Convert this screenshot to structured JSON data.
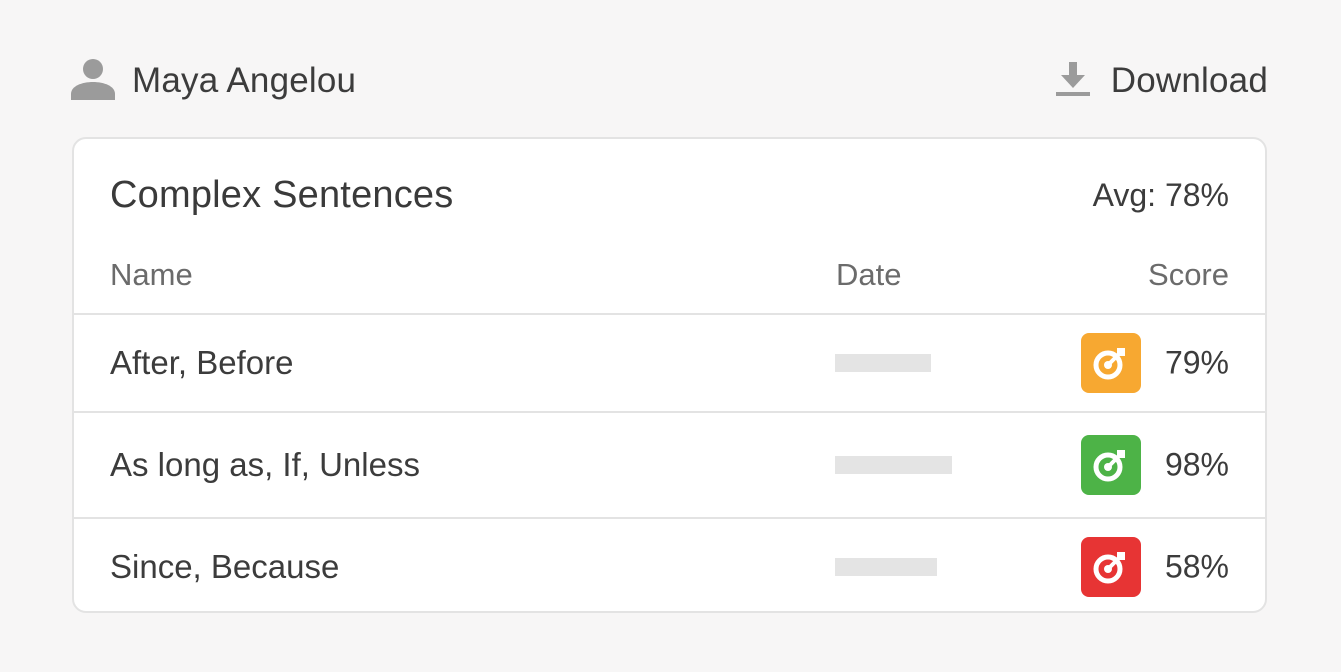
{
  "user": {
    "name": "Maya Angelou",
    "icon": "person-icon"
  },
  "download": {
    "label": "Download",
    "icon": "download-icon"
  },
  "card": {
    "title": "Complex Sentences",
    "avg": "Avg: 78%",
    "columns": {
      "name": "Name",
      "date": "Date",
      "score": "Score"
    },
    "rows": [
      {
        "name": "After, Before",
        "score": "79%",
        "score_fraction": 0.79,
        "badge_color": "#f7a831",
        "icon": "target-icon"
      },
      {
        "name": "As long as, If, Unless",
        "score": "98%",
        "score_fraction": 0.98,
        "badge_color": "#4db347",
        "icon": "target-icon"
      },
      {
        "name": "Since, Because",
        "score": "58%",
        "score_fraction": 0.58,
        "badge_color": "#e73434",
        "icon": "target-icon"
      }
    ]
  },
  "colors": {
    "background": "#f7f6f6",
    "card": "#ffffff",
    "border": "#e3e3e3",
    "text": "#3c3c3c",
    "muted": "#6b6b6b",
    "icon_gray": "#9b9b9b",
    "placeholder": "#e4e4e4"
  }
}
